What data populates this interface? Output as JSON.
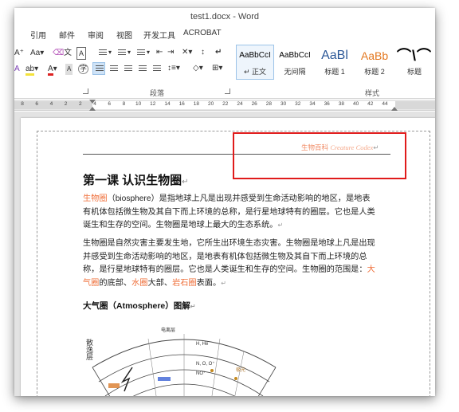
{
  "window": {
    "title": "test1.docx - Word"
  },
  "tabs": [
    "引用",
    "邮件",
    "审阅",
    "视图",
    "开发工具",
    "ACROBAT"
  ],
  "ribbon": {
    "font_size_label": "Aa",
    "font_color_label": "A",
    "paragraph_group": "段落",
    "styles_group": "样式",
    "styles": [
      {
        "preview": "AaBbCcI",
        "name": "↵ 正文"
      },
      {
        "preview": "AaBbCcI",
        "name": "无间隔"
      },
      {
        "preview": "AaBl",
        "name": "标题 1"
      },
      {
        "preview": "AaBb",
        "name": "标题 2"
      },
      {
        "preview": "",
        "name": "标题"
      }
    ]
  },
  "ruler": {
    "ticks": [
      "8",
      "6",
      "4",
      "2",
      "2",
      "4",
      "6",
      "8",
      "10",
      "12",
      "14",
      "16",
      "18",
      "20",
      "22",
      "24",
      "26",
      "28",
      "30",
      "32",
      "34",
      "36",
      "38",
      "40",
      "42",
      "44"
    ]
  },
  "document": {
    "header_cn": "生物百科",
    "header_en": "Creature Codex",
    "title": "第一课 认识生物圈",
    "para1": {
      "highlight": "生物圈",
      "rest": "（biosphere）是指地球上凡是出现并感受到生命活动影响的地区，是地表有机体包括微生物及其自下而上环境的总称，是行星地球特有的圈层。它也是人类诞生和生存的空间。生物圈是地球上最大的生态系统。"
    },
    "para2": {
      "text": "生物圈是自然灾害主要发生地，它所生出环境生态灾害。生物圈是地球上凡是出现并感受到生命活动影响的地区，是地表有机体包括微生物及其自下而上环境的总称，是行星地球特有的圈层。它也是人类诞生和生存的空间。生物圈的范围是：",
      "h1": "大气圈",
      "m1": "的底部、",
      "h2": "水圈",
      "m2": "大部、",
      "h3": "岩石圈",
      "end": "表面。"
    },
    "subheading": "大气圈（Atmosphere）图解",
    "diagram_labels": {
      "vertical_left": "散逸层",
      "top_a": "电离层",
      "h_he": "H, He",
      "oxygen": "N, O, O⁺",
      "no": "NO⁺",
      "aurora": "极光"
    }
  },
  "colors": {
    "accent_orange": "#ef6f3a",
    "annotation_red": "#e01b1b",
    "selection_blue": "#cfe3f7"
  }
}
